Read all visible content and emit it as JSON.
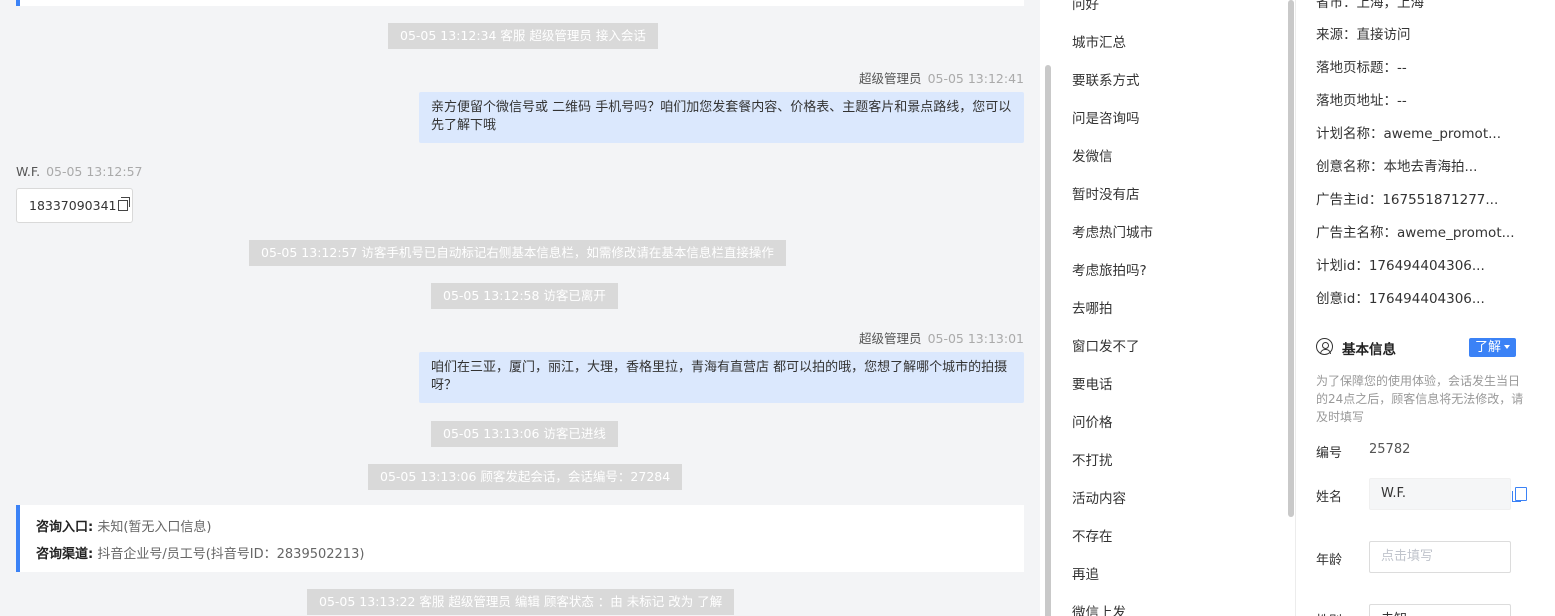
{
  "chat": {
    "sys1": "05-05 13:12:34 客服 超级管理员 接入会话",
    "msg1": {
      "who": "超级管理员",
      "time": "05-05 13:12:41",
      "text": "亲方便留个微信号或 二维码 手机号吗？咱们加您发套餐内容、价格表、主题客片和景点路线，您可以先了解下哦"
    },
    "visitor": {
      "who": "W.F.",
      "time": "05-05 13:12:57",
      "phone": "18337090341"
    },
    "sys2": "05-05 13:12:57 访客手机号已自动标记右侧基本信息栏，如需修改请在基本信息栏直接操作",
    "sys3": "05-05 13:12:58 访客已离开",
    "msg2": {
      "who": "超级管理员",
      "time": "05-05 13:13:01",
      "text": "咱们在三亚，厦门，丽江，大理，香格里拉，青海有直营店 都可以拍的哦，您想了解哪个城市的拍摄呀？"
    },
    "sys4": "05-05 13:13:06 访客已进线",
    "sys5": "05-05 13:13:06 顾客发起会话，会话编号：27284",
    "info": {
      "entry_label": "咨询入口:",
      "entry_value": "未知(暂无入口信息)",
      "channel_label": "咨询渠道:",
      "channel_value": "抖音企业号/员工号(抖音号ID：2839502213)"
    },
    "sys6": "05-05 13:13:22 客服 超级管理员 编辑 顾客状态 ：由 未标记 改为 了解"
  },
  "quick_replies": [
    "问好",
    "城市汇总",
    "要联系方式",
    "问是咨询吗",
    "发微信",
    "暂时没有店",
    "考虑热门城市",
    "考虑旅拍吗?",
    "去哪拍",
    "窗口发不了",
    "要电话",
    "问价格",
    "不打扰",
    "活动内容",
    "不存在",
    "再追",
    "微信上发"
  ],
  "side": {
    "rows": [
      "省市：上海，上海",
      "来源：直接访问",
      "落地页标题：--",
      "落地页地址：--",
      "计划名称：aweme_promot...",
      "创意名称：本地去青海拍...",
      "广告主id：167551871277...",
      "广告主名称：aweme_promot...",
      "计划id：176494404306...",
      "创意id：176494404306..."
    ],
    "basic_title": "基本信息",
    "status_label": "了解",
    "notice": "为了保障您的使用体验，会话发生当日的24点之后，顾客信息将无法修改，请及时填写",
    "id_label": "编号",
    "id_value": "25782",
    "name_label": "姓名",
    "name_value": "W.F.",
    "age_label": "年龄",
    "age_placeholder": "点击填写",
    "gender_label": "性别",
    "gender_value": "未知"
  }
}
